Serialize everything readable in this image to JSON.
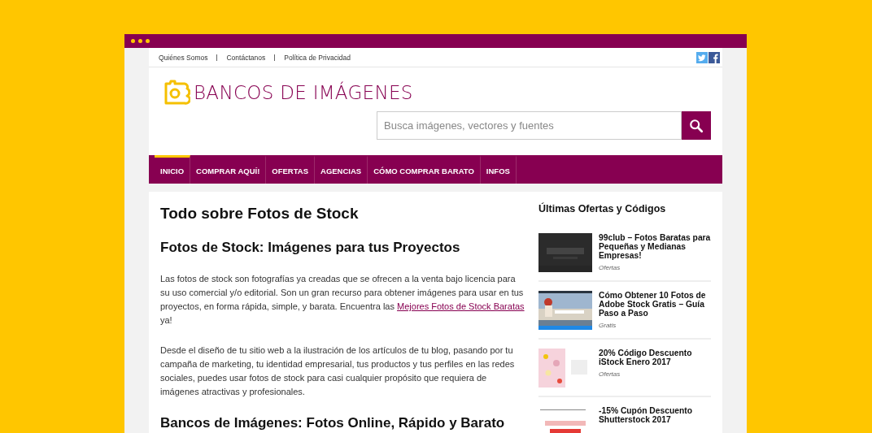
{
  "top_links": [
    "Quiénes Somos",
    "Contáctanos",
    "Política de Privacidad"
  ],
  "logo": {
    "text": "BANCOS DE IMÁGENES"
  },
  "search": {
    "placeholder": "Busca imágenes, vectores y fuentes"
  },
  "nav": [
    {
      "label": "INICIO",
      "selected": true
    },
    {
      "label": "COMPRAR AQUÍ!",
      "selected": false
    },
    {
      "label": "OFERTAS",
      "selected": false
    },
    {
      "label": "AGENCIAS",
      "selected": false
    },
    {
      "label": "CÓMO COMPRAR BARATO",
      "selected": false
    },
    {
      "label": "INFOS",
      "selected": false
    }
  ],
  "main": {
    "title": "Todo sobre Fotos de Stock",
    "sections": [
      {
        "heading": "Fotos de Stock: Imágenes para tus Proyectos",
        "paragraphs": [
          {
            "text": "Las fotos de stock son fotografías ya creadas que se ofrecen a la venta bajo licencia para su uso comercial y/o editorial. Son un gran recurso para obtener imágenes para usar en tus proyectos, en forma rápida, simple, y barata. Encuentra las ",
            "link": "Mejores Fotos de Stock Baratas",
            "after": " ya!"
          },
          {
            "text": "Desde el diseño de tu sitio web a la ilustración de los artículos de tu blog, pasando por tu campaña de marketing, tu identidad empresarial, tus productos y tus perfiles en las redes sociales, puedes usar fotos de stock para casi cualquier propósito que requiera de imágenes atractivas y profesionales."
          }
        ]
      },
      {
        "heading": "Bancos de Imágenes: Fotos Online, Rápido y Barato"
      }
    ]
  },
  "sidebar": {
    "title": "Últimas Ofertas y Códigos",
    "posts": [
      {
        "title": "99club – Fotos Baratas para Pequeñas y Medianas Empresas!",
        "category": "Ofertas"
      },
      {
        "title": "Cómo Obtener 10 Fotos de Adobe Stock Gratis – Guía Paso a Paso",
        "category": "Gratis"
      },
      {
        "title": "20% Código Descuento iStock Enero 2017",
        "category": "Ofertas"
      },
      {
        "title": "-15% Cupón Descuento Shutterstock 2017"
      }
    ]
  }
}
